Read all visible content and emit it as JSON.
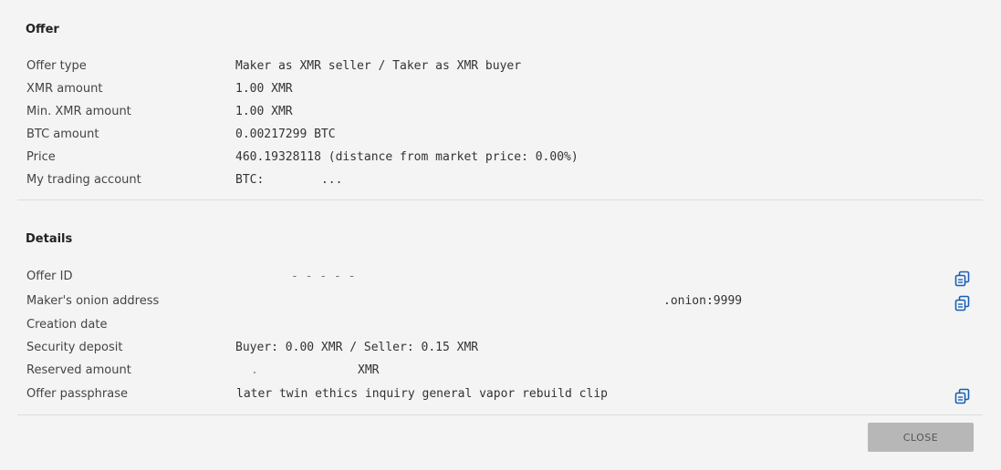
{
  "offer": {
    "title": "Offer",
    "rows": [
      {
        "label": "Offer type",
        "value": "Maker as XMR seller / Taker as XMR buyer"
      },
      {
        "label": "XMR amount",
        "value": "1.00 XMR"
      },
      {
        "label": "Min. XMR amount",
        "value": "1.00 XMR"
      },
      {
        "label": "BTC amount",
        "value": "0.00217299 BTC"
      },
      {
        "label": "Price",
        "value": "460.19328118 (distance from market price: 0.00%)"
      },
      {
        "label": "My trading account",
        "value_prefix": "BTC:",
        "value_suffix": "..."
      }
    ]
  },
  "details": {
    "title": "Details",
    "rows": [
      {
        "label": "Offer ID",
        "value": "-  -  -  -  -"
      },
      {
        "label": "Maker's onion address",
        "value": ".onion:9999"
      },
      {
        "label": "Creation date",
        "value": ""
      },
      {
        "label": "Security deposit",
        "value": "Buyer: 0.00 XMR / Seller: 0.15 XMR"
      },
      {
        "label": "Reserved amount",
        "value_prefix": ".",
        "value_suffix": "XMR"
      },
      {
        "label": "Offer passphrase",
        "value": "later twin ethics inquiry general vapor rebuild clip"
      }
    ]
  },
  "footer": {
    "close_label": "CLOSE"
  },
  "colors": {
    "accent": "#1a5fb4",
    "button_bg": "#b7b7b7"
  }
}
